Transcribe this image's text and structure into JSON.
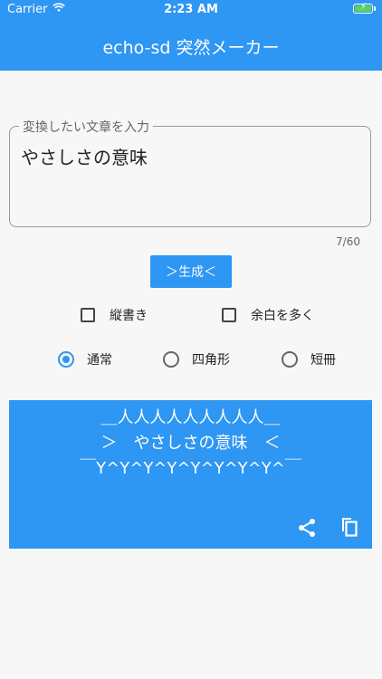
{
  "status": {
    "carrier": "Carrier",
    "time": "2:23 AM"
  },
  "app": {
    "title": "echo-sd 突然メーカー"
  },
  "input": {
    "label": "変換したい文章を入力",
    "value": "やさしさの意味",
    "counter": "7/60"
  },
  "generate_button": {
    "label": "＞生成＜"
  },
  "options": {
    "checkboxes": [
      {
        "label": "縦書き",
        "checked": false
      },
      {
        "label": "余白を多く",
        "checked": false
      }
    ],
    "radios": [
      {
        "label": "通常",
        "selected": true
      },
      {
        "label": "四角形",
        "selected": false
      },
      {
        "label": "短冊",
        "selected": false
      }
    ]
  },
  "output": {
    "line1": "＿人人人人人人人人人＿",
    "line2": "＞　やさしさの意味　＜",
    "line3": "￣Y^Y^Y^Y^Y^Y^Y^Y^￣"
  },
  "icons": {
    "share": "share-icon",
    "copy": "copy-icon"
  },
  "colors": {
    "accent": "#2e96f3",
    "background": "#f7f7f7"
  }
}
